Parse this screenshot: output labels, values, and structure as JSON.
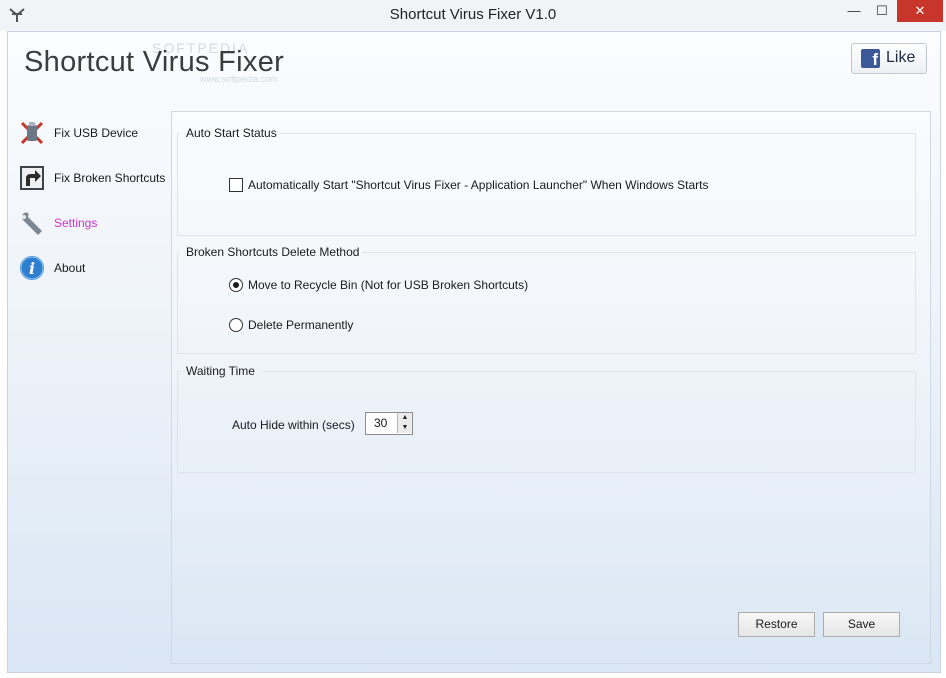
{
  "window": {
    "title": "Shortcut Virus Fixer V1.0",
    "min_glyph": "—",
    "max_glyph": "☐",
    "close_glyph": "✕"
  },
  "header": {
    "app_title": "Shortcut Virus Fixer",
    "like_label": "Like",
    "fb_glyph": "f",
    "watermark": "SOFTPEDIA",
    "watermark_url": "www.softpedia.com"
  },
  "sidebar": {
    "items": [
      {
        "label": "Fix USB Device",
        "icon": "usb-repair-icon",
        "active": false
      },
      {
        "label": "Fix Broken Shortcuts",
        "icon": "shortcut-arrow-icon",
        "active": false
      },
      {
        "label": "Settings",
        "icon": "wrench-icon",
        "active": true
      },
      {
        "label": "About",
        "icon": "info-icon",
        "active": false
      }
    ]
  },
  "settings": {
    "auto_start": {
      "title": "Auto Start Status",
      "checkbox_label": "Automatically Start \"Shortcut Virus Fixer - Application Launcher\" When Windows Starts",
      "checked": false
    },
    "delete_method": {
      "title": "Broken Shortcuts Delete Method",
      "options": [
        {
          "label": "Move to Recycle Bin (Not for USB Broken Shortcuts)",
          "selected": true
        },
        {
          "label": "Delete Permanently",
          "selected": false
        }
      ]
    },
    "waiting_time": {
      "title": "Waiting Time",
      "label": "Auto Hide within (secs)",
      "value": "30"
    }
  },
  "buttons": {
    "restore": "Restore",
    "save": "Save"
  },
  "colors": {
    "active_nav": "#cc33cc",
    "close_button": "#c7352b",
    "facebook": "#3b5998"
  }
}
